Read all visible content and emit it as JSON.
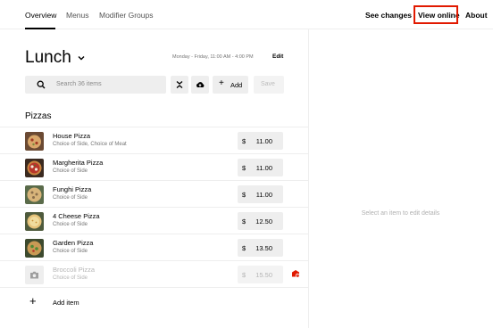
{
  "nav": {
    "tabs": [
      {
        "label": "Overview"
      },
      {
        "label": "Menus"
      },
      {
        "label": "Modifier Groups"
      }
    ],
    "see_changes": "See changes",
    "view_online": "View online",
    "about": "About"
  },
  "menu": {
    "title": "Lunch",
    "schedule": "Monday - Friday, 11:00 AM - 4:00 PM",
    "edit_label": "Edit"
  },
  "toolbar": {
    "search_placeholder": "Search 36 items",
    "add_label": "Add",
    "save_label": "Save"
  },
  "section": {
    "title": "Pizzas",
    "items": [
      {
        "name": "House Pizza",
        "desc": "Choice of Side, Choice of Meat",
        "currency": "$",
        "price": "11.00"
      },
      {
        "name": "Margherita Pizza",
        "desc": "Choice of Side",
        "currency": "$",
        "price": "11.00"
      },
      {
        "name": "Funghi Pizza",
        "desc": "Choice of Side",
        "currency": "$",
        "price": "11.00"
      },
      {
        "name": "4 Cheese Pizza",
        "desc": "Choice of Side",
        "currency": "$",
        "price": "12.50"
      },
      {
        "name": "Garden Pizza",
        "desc": "Choice of Side",
        "currency": "$",
        "price": "13.50"
      },
      {
        "name": "Broccoli Pizza",
        "desc": "Choice of Side",
        "currency": "$",
        "price": "15.50"
      }
    ],
    "add_item_label": "Add item"
  },
  "detail_panel": {
    "hint": "Select an item to edit details"
  },
  "colors": {
    "highlight": "#e11900",
    "warning": "#e11900"
  }
}
